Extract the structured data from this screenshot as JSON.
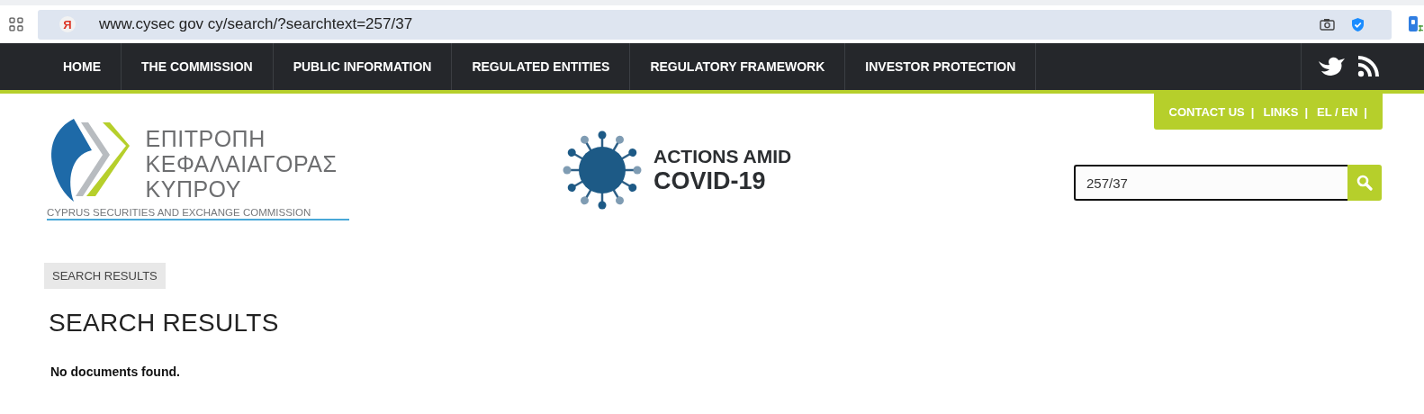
{
  "address_bar": {
    "favicon_letter": "Я",
    "url": "www.cysec gov cy/search/?searchtext=257/37"
  },
  "nav": {
    "items": [
      {
        "label": "HOME"
      },
      {
        "label": "THE COMMISSION"
      },
      {
        "label": "PUBLIC INFORMATION"
      },
      {
        "label": "REGULATED ENTITIES"
      },
      {
        "label": "REGULATORY FRAMEWORK"
      },
      {
        "label": "INVESTOR PROTECTION"
      }
    ]
  },
  "top_links": {
    "separator": "|",
    "items": [
      "CONTACT US",
      "LINKS",
      "EL / EN"
    ]
  },
  "logo": {
    "greek_lines": [
      "ΕΠΙΤΡΟΠΗ",
      "ΚΕΦΑΛΑΙΑΓΟΡΑΣ",
      "ΚΥΠΡΟΥ"
    ],
    "subtitle": "CYPRUS SECURITIES AND EXCHANGE COMMISSION"
  },
  "covid_banner": {
    "line_1": "ACTIONS AMID",
    "line_2": "COVID-19"
  },
  "search": {
    "value": "257/37"
  },
  "breadcrumb": "SEARCH RESULTS",
  "heading": "SEARCH RESULTS",
  "message": "No documents found."
}
